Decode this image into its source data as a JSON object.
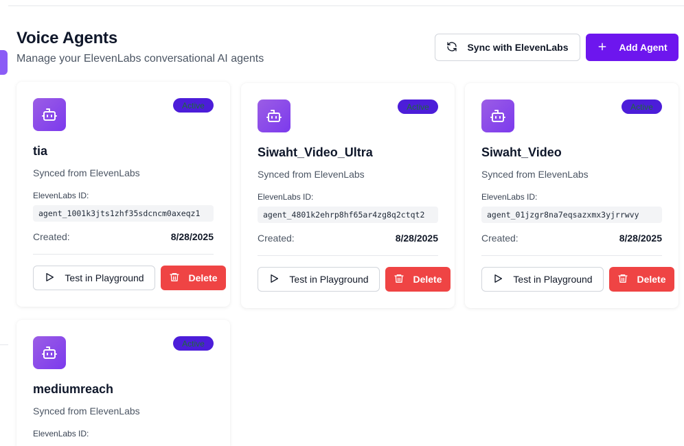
{
  "header": {
    "title": "Voice Agents",
    "subtitle": "Manage your ElevenLabs conversational AI agents",
    "sync_label": "Sync with ElevenLabs",
    "add_label": "Add Agent"
  },
  "colors": {
    "accent": "#6d16ee",
    "badge": "#4c1dd9",
    "delete": "#ef4444"
  },
  "agents": [
    {
      "name": "tia",
      "source": "Synced from ElevenLabs",
      "status": "Active",
      "id_label": "ElevenLabs ID:",
      "id": "agent_1001k3jts1zhf35sdcncm0axeqz1",
      "created_label": "Created:",
      "created": "8/28/2025",
      "test_label": "Test in Playground",
      "delete_label": "Delete"
    },
    {
      "name": "Siwaht_Video_Ultra",
      "source": "Synced from ElevenLabs",
      "status": "Active",
      "id_label": "ElevenLabs ID:",
      "id": "agent_4801k2ehrp8hf65ar4zg8q2ctqt2",
      "created_label": "Created:",
      "created": "8/28/2025",
      "test_label": "Test in Playground",
      "delete_label": "Delete"
    },
    {
      "name": "Siwaht_Video",
      "source": "Synced from ElevenLabs",
      "status": "Active",
      "id_label": "ElevenLabs ID:",
      "id": "agent_01jzgr8na7eqsazxmx3yjrrwvy",
      "created_label": "Created:",
      "created": "8/28/2025",
      "test_label": "Test in Playground",
      "delete_label": "Delete"
    },
    {
      "name": "mediumreach",
      "source": "Synced from ElevenLabs",
      "status": "Active",
      "id_label": "ElevenLabs ID:"
    }
  ]
}
